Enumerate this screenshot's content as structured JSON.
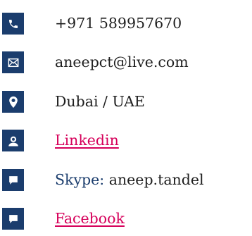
{
  "colors": {
    "icon_bg": "#1b3d6d",
    "icon_fg": "#ffffff",
    "text": "#1f1f1f",
    "link": "#d6005a",
    "skype_label": "#1b3d6d"
  },
  "contacts": [
    {
      "icon": "phone-icon",
      "text": "+971 589957670"
    },
    {
      "icon": "envelope-icon",
      "text": "aneepct@live.com"
    },
    {
      "icon": "map-pin-icon",
      "text": "Dubai / UAE"
    },
    {
      "icon": "person-chat-icon",
      "text": "Linkedin"
    },
    {
      "icon": "chat-bubble-icon",
      "label": "Skype:",
      "value": "aneep.tandel"
    },
    {
      "icon": "chat-bubble-icon",
      "text": "Facebook"
    }
  ]
}
